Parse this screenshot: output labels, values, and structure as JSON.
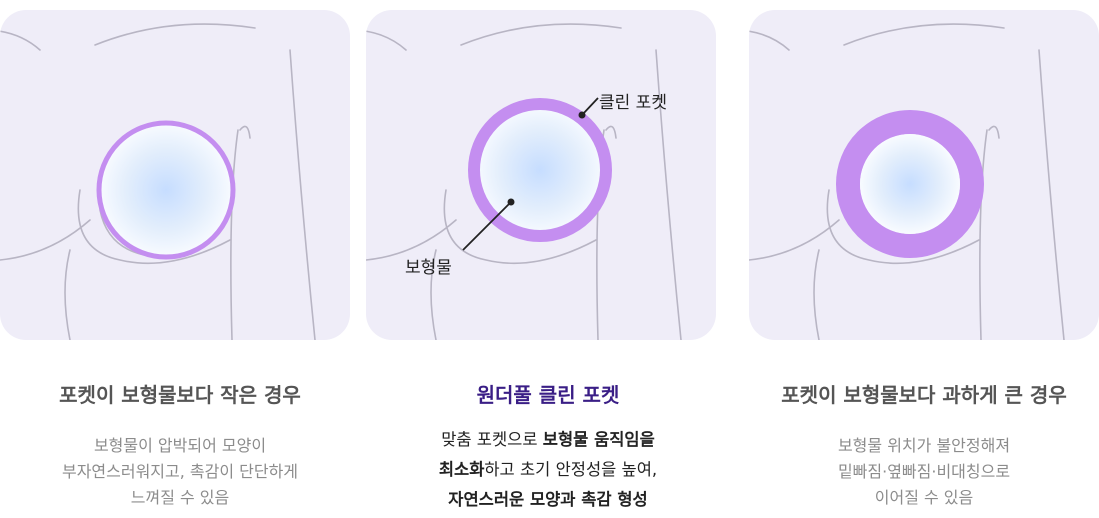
{
  "colors": {
    "panel_bg": "#efedf8",
    "pocket_purple": "#c48ef0",
    "implant_center": "#c9e1ff",
    "title_highlight": "#3a1e86"
  },
  "center_panel": {
    "pocket_label": "클린 포켓",
    "implant_label": "보형물"
  },
  "captions": [
    {
      "title": "포켓이 보형물보다 작은 경우",
      "lines": [
        "보형물이 압박되어 모양이",
        "부자연스러워지고, 촉감이 단단하게",
        "느껴질 수 있음"
      ]
    },
    {
      "title": "원더풀 클린 포켓",
      "line1_a": "맞춤 포켓으로 ",
      "line1_b": "보형물 움직임을",
      "line2_a": "최소화",
      "line2_b": "하고 초기 안정성을 높여,",
      "line3": "자연스러운 모양과 촉감 형성"
    },
    {
      "title": "포켓이 보형물보다 과하게 큰 경우",
      "lines": [
        "보형물 위치가 불안정해져",
        "밑빠짐·옆빠짐·비대칭으로",
        "이어질 수 있음"
      ]
    }
  ]
}
